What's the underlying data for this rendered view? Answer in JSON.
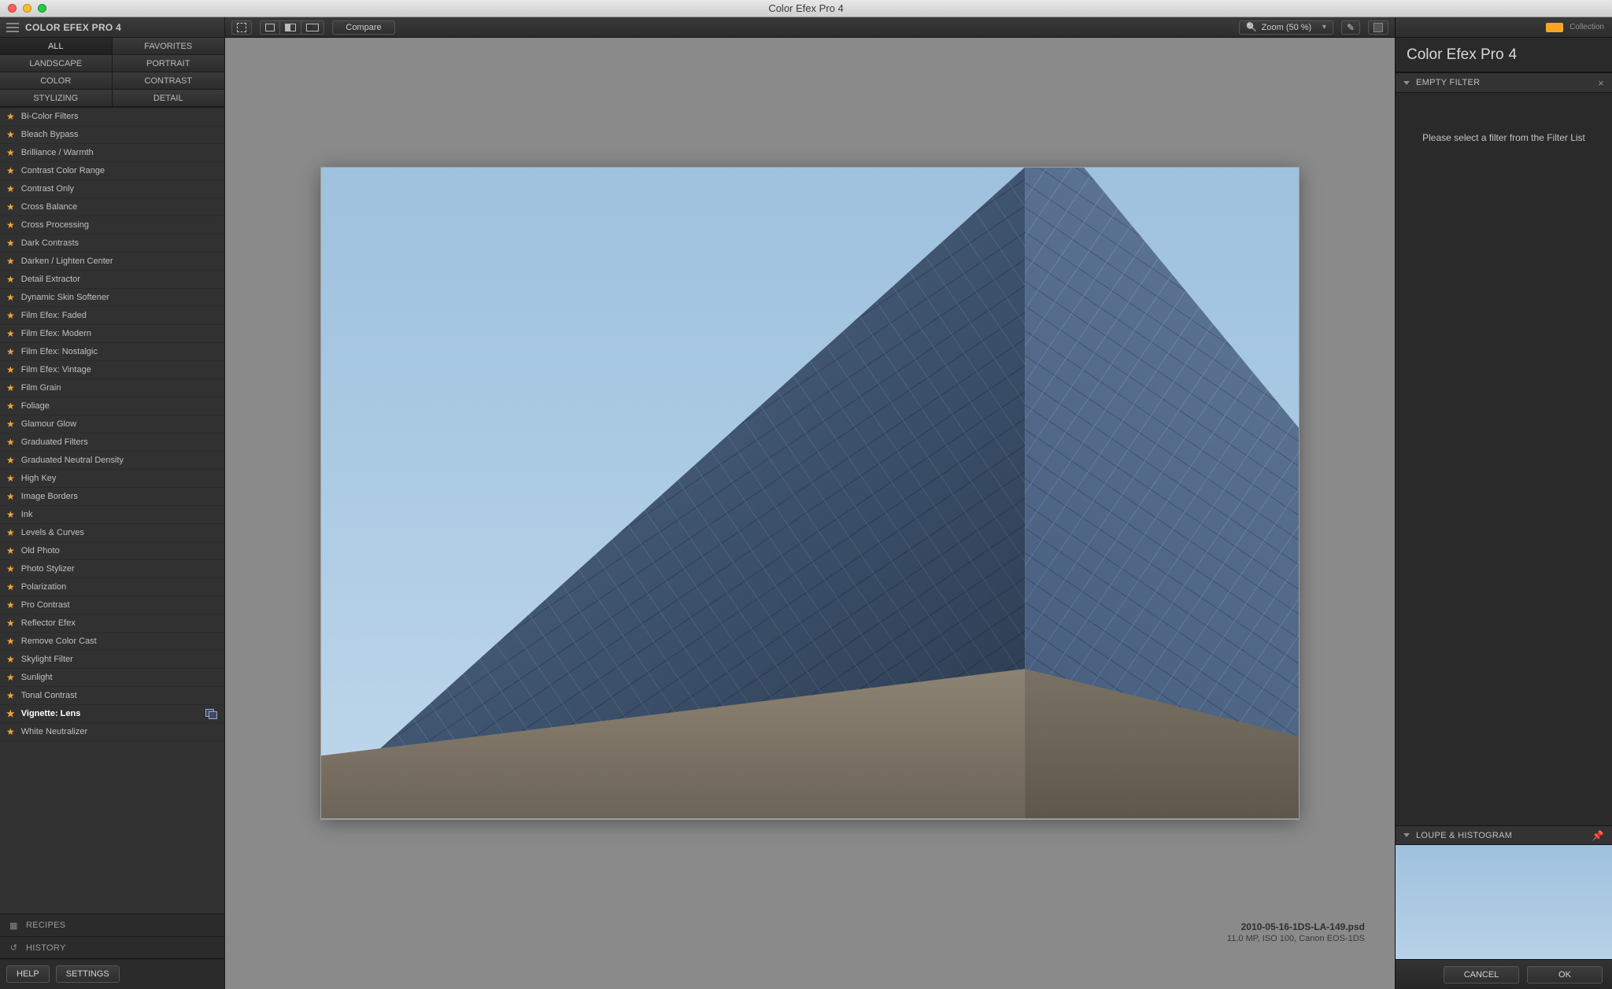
{
  "window": {
    "title": "Color Efex Pro 4"
  },
  "left": {
    "caption": "COLOR EFEX PRO 4",
    "tabs": [
      "ALL",
      "FAVORITES",
      "LANDSCAPE",
      "PORTRAIT",
      "COLOR",
      "CONTRAST",
      "STYLIZING",
      "DETAIL"
    ],
    "active_tab": "ALL",
    "filters": [
      "Bi-Color Filters",
      "Bleach Bypass",
      "Brilliance / Warmth",
      "Contrast Color Range",
      "Contrast Only",
      "Cross Balance",
      "Cross Processing",
      "Dark Contrasts",
      "Darken / Lighten Center",
      "Detail Extractor",
      "Dynamic Skin Softener",
      "Film Efex: Faded",
      "Film Efex: Modern",
      "Film Efex: Nostalgic",
      "Film Efex: Vintage",
      "Film Grain",
      "Foliage",
      "Glamour Glow",
      "Graduated Filters",
      "Graduated Neutral Density",
      "High Key",
      "Image Borders",
      "Ink",
      "Levels & Curves",
      "Old Photo",
      "Photo Stylizer",
      "Polarization",
      "Pro Contrast",
      "Reflector Efex",
      "Remove Color Cast",
      "Skylight Filter",
      "Sunlight",
      "Tonal Contrast",
      "Vignette: Lens",
      "White Neutralizer"
    ],
    "selected_filter": "Vignette: Lens",
    "sections": {
      "recipes": "RECIPES",
      "history": "HISTORY"
    },
    "footer": {
      "help": "HELP",
      "settings": "SETTINGS"
    }
  },
  "toolbar": {
    "compare": "Compare",
    "zoom_label": "Zoom (50 %)"
  },
  "image": {
    "filename": "2010-05-16-1DS-LA-149.psd",
    "meta": "11.0 MP, ISO 100, Canon EOS-1DS"
  },
  "right": {
    "brand_suffix": "Collection",
    "title": "Color Efex Pro",
    "version": "4",
    "empty": {
      "header": "EMPTY FILTER",
      "message": "Please select a filter from the Filter List"
    },
    "loupe": "LOUPE & HISTOGRAM",
    "cancel": "CANCEL",
    "ok": "OK"
  }
}
